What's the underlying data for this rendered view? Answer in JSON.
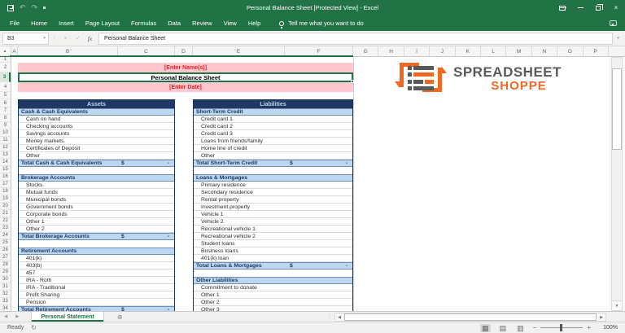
{
  "colors": {
    "excel_green": "#217346",
    "banner_pink": "#ffc7ce",
    "banner_red": "#e1252d",
    "header_navy": "#1f3864",
    "light_blue": "#bdd7ee",
    "logo_gray": "#58595b",
    "logo_orange": "#f26822"
  },
  "title_bar": {
    "title": "Personal Balance Sheet  [Protected View] -  Excel"
  },
  "ribbon": {
    "tabs": [
      "File",
      "Home",
      "Insert",
      "Page Layout",
      "Formulas",
      "Data",
      "Review",
      "View",
      "Help"
    ],
    "tell_me": "Tell me what you want to do"
  },
  "formula_bar": {
    "name_box": "B3",
    "cancel": "×",
    "enter": "✓",
    "fx_label": "fx",
    "content": "Personal Balance Sheet"
  },
  "grid": {
    "columns_left": [
      "A",
      "B",
      "C",
      "D",
      "E",
      "F"
    ],
    "columns_right": [
      "G",
      "H",
      "I",
      "J",
      "K",
      "L",
      "M",
      "N",
      "O",
      "P"
    ],
    "row_count": 34,
    "selected_row": 3,
    "banner": {
      "name_placeholder": "[Enter Name(s)]",
      "title": "Personal Balance Sheet",
      "date_placeholder": "[Enter Date]"
    }
  },
  "assets_table": {
    "header": "Assets",
    "rows": [
      {
        "type": "section",
        "label": "Cash & Cash Equivalents"
      },
      {
        "type": "item",
        "label": "Cash on hand"
      },
      {
        "type": "item",
        "label": "Checking accounts"
      },
      {
        "type": "item",
        "label": "Savings accounts"
      },
      {
        "type": "item",
        "label": "Money markets"
      },
      {
        "type": "item",
        "label": "Certificates of Deposit"
      },
      {
        "type": "item",
        "label": "Other"
      },
      {
        "type": "total",
        "label": "Total Cash & Cash Equivalents",
        "currency": "$",
        "value": "-"
      },
      {
        "type": "gap",
        "label": ""
      },
      {
        "type": "section",
        "label": "Brokerage Accounts"
      },
      {
        "type": "item",
        "label": "Stocks"
      },
      {
        "type": "item",
        "label": "Mutual funds"
      },
      {
        "type": "item",
        "label": "Municipal bonds"
      },
      {
        "type": "item",
        "label": "Government bonds"
      },
      {
        "type": "item",
        "label": "Corporate bonds"
      },
      {
        "type": "item",
        "label": "Other 1"
      },
      {
        "type": "item",
        "label": "Other 2"
      },
      {
        "type": "total",
        "label": "Total Brokerage Accounts",
        "currency": "$",
        "value": "-"
      },
      {
        "type": "gap",
        "label": ""
      },
      {
        "type": "section",
        "label": "Retirement Accounts"
      },
      {
        "type": "item",
        "label": "401(k)"
      },
      {
        "type": "item",
        "label": "403(b)"
      },
      {
        "type": "item",
        "label": "457"
      },
      {
        "type": "item",
        "label": "IRA - Roth"
      },
      {
        "type": "item",
        "label": "IRA - Traditional"
      },
      {
        "type": "item",
        "label": "Profit Sharing"
      },
      {
        "type": "item",
        "label": "Pension"
      },
      {
        "type": "total",
        "label": "Total Retirement Accounts",
        "currency": "$",
        "value": "-"
      }
    ]
  },
  "liabilities_table": {
    "header": "Liabilities",
    "rows": [
      {
        "type": "section",
        "label": "Short-Term Credit"
      },
      {
        "type": "item",
        "label": "Credit card 1"
      },
      {
        "type": "item",
        "label": "Credit card 2"
      },
      {
        "type": "item",
        "label": "Credit card 3"
      },
      {
        "type": "item",
        "label": "Loans from friends/family"
      },
      {
        "type": "item",
        "label": "Home line of credit"
      },
      {
        "type": "item",
        "label": "Other"
      },
      {
        "type": "total",
        "label": "Total Short-Term Credit",
        "currency": "$",
        "value": "-"
      },
      {
        "type": "gap",
        "label": ""
      },
      {
        "type": "section",
        "label": "Loans & Mortgages"
      },
      {
        "type": "item",
        "label": "Primary residence"
      },
      {
        "type": "item",
        "label": "Secondary residence"
      },
      {
        "type": "item",
        "label": "Rental property"
      },
      {
        "type": "item",
        "label": "Investment property"
      },
      {
        "type": "item",
        "label": "Vehicle 1"
      },
      {
        "type": "item",
        "label": "Vehicle 2"
      },
      {
        "type": "item",
        "label": "Recreational vehicle 1"
      },
      {
        "type": "item",
        "label": "Recreational vehicle 2"
      },
      {
        "type": "item",
        "label": "Student loans"
      },
      {
        "type": "item",
        "label": "Business loans"
      },
      {
        "type": "item",
        "label": "401(k) loan"
      },
      {
        "type": "total",
        "label": "Total Loans & Mortgages",
        "currency": "$",
        "value": "-"
      },
      {
        "type": "gap",
        "label": ""
      },
      {
        "type": "section",
        "label": "Other Liabilities"
      },
      {
        "type": "item",
        "label": "Commitment to donate"
      },
      {
        "type": "item",
        "label": "Other 1"
      },
      {
        "type": "item",
        "label": "Other 2"
      },
      {
        "type": "item",
        "label": "Other 3"
      }
    ]
  },
  "logo": {
    "line1": "SPREADSHEET",
    "line2": "SHOPPE"
  },
  "sheet_tabs": {
    "active_tab": "Personal Statement"
  },
  "status_bar": {
    "mode": "Ready",
    "zoom_level": "100%"
  }
}
